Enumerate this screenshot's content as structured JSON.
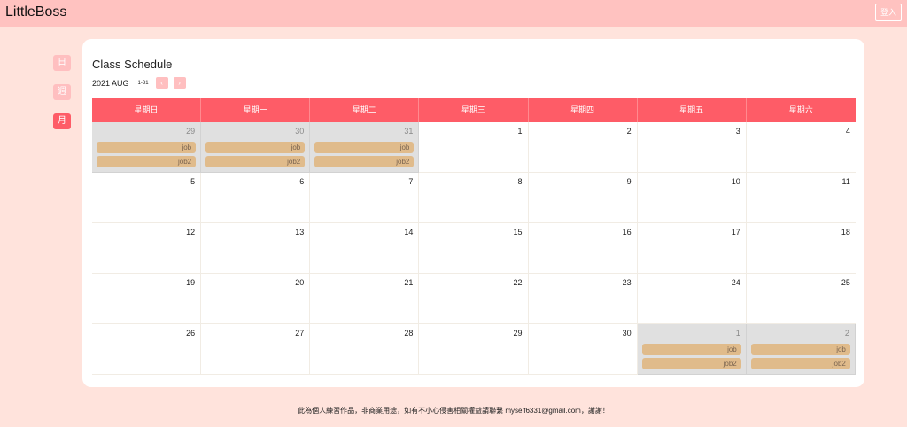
{
  "header": {
    "brand": "LittleBoss",
    "login_label": "登入"
  },
  "sidebar": {
    "views": [
      {
        "label": "日",
        "active": false
      },
      {
        "label": "週",
        "active": false
      },
      {
        "label": "月",
        "active": true
      }
    ]
  },
  "schedule": {
    "title": "Class Schedule",
    "month_label": "2021 AUG",
    "range_label": "1-31",
    "prev_label": "‹",
    "next_label": "›"
  },
  "calendar": {
    "weekdays": [
      "星期日",
      "星期一",
      "星期二",
      "星期三",
      "星期四",
      "星期五",
      "星期六"
    ],
    "weeks": [
      [
        {
          "day": "29",
          "other": true,
          "events": [
            "job",
            "job2"
          ]
        },
        {
          "day": "30",
          "other": true,
          "events": [
            "job",
            "job2"
          ]
        },
        {
          "day": "31",
          "other": true,
          "events": [
            "job",
            "job2"
          ]
        },
        {
          "day": "1",
          "other": false,
          "events": []
        },
        {
          "day": "2",
          "other": false,
          "events": []
        },
        {
          "day": "3",
          "other": false,
          "events": []
        },
        {
          "day": "4",
          "other": false,
          "events": []
        }
      ],
      [
        {
          "day": "5",
          "other": false,
          "events": []
        },
        {
          "day": "6",
          "other": false,
          "events": []
        },
        {
          "day": "7",
          "other": false,
          "events": []
        },
        {
          "day": "8",
          "other": false,
          "events": []
        },
        {
          "day": "9",
          "other": false,
          "events": []
        },
        {
          "day": "10",
          "other": false,
          "events": []
        },
        {
          "day": "11",
          "other": false,
          "events": []
        }
      ],
      [
        {
          "day": "12",
          "other": false,
          "events": []
        },
        {
          "day": "13",
          "other": false,
          "events": []
        },
        {
          "day": "14",
          "other": false,
          "events": []
        },
        {
          "day": "15",
          "other": false,
          "events": []
        },
        {
          "day": "16",
          "other": false,
          "events": []
        },
        {
          "day": "17",
          "other": false,
          "events": []
        },
        {
          "day": "18",
          "other": false,
          "events": []
        }
      ],
      [
        {
          "day": "19",
          "other": false,
          "events": []
        },
        {
          "day": "20",
          "other": false,
          "events": []
        },
        {
          "day": "21",
          "other": false,
          "events": []
        },
        {
          "day": "22",
          "other": false,
          "events": []
        },
        {
          "day": "23",
          "other": false,
          "events": []
        },
        {
          "day": "24",
          "other": false,
          "events": []
        },
        {
          "day": "25",
          "other": false,
          "events": []
        }
      ],
      [
        {
          "day": "26",
          "other": false,
          "events": []
        },
        {
          "day": "27",
          "other": false,
          "events": []
        },
        {
          "day": "28",
          "other": false,
          "events": []
        },
        {
          "day": "29",
          "other": false,
          "events": []
        },
        {
          "day": "30",
          "other": false,
          "events": []
        },
        {
          "day": "1",
          "other": true,
          "events": [
            "job",
            "job2"
          ]
        },
        {
          "day": "2",
          "other": true,
          "events": [
            "job",
            "job2"
          ]
        }
      ]
    ]
  },
  "footer": {
    "text": "此為個人練習作品，非商業用途，如有不小心侵害相關權益請聯繫 myself6331@gmail.com，謝謝！"
  },
  "colors": {
    "accent": "#fe5c67",
    "accent_light": "#ffbfc0",
    "event": "#e0bb8b",
    "background": "#ffe3dc",
    "topbar": "#ffc2c0"
  }
}
